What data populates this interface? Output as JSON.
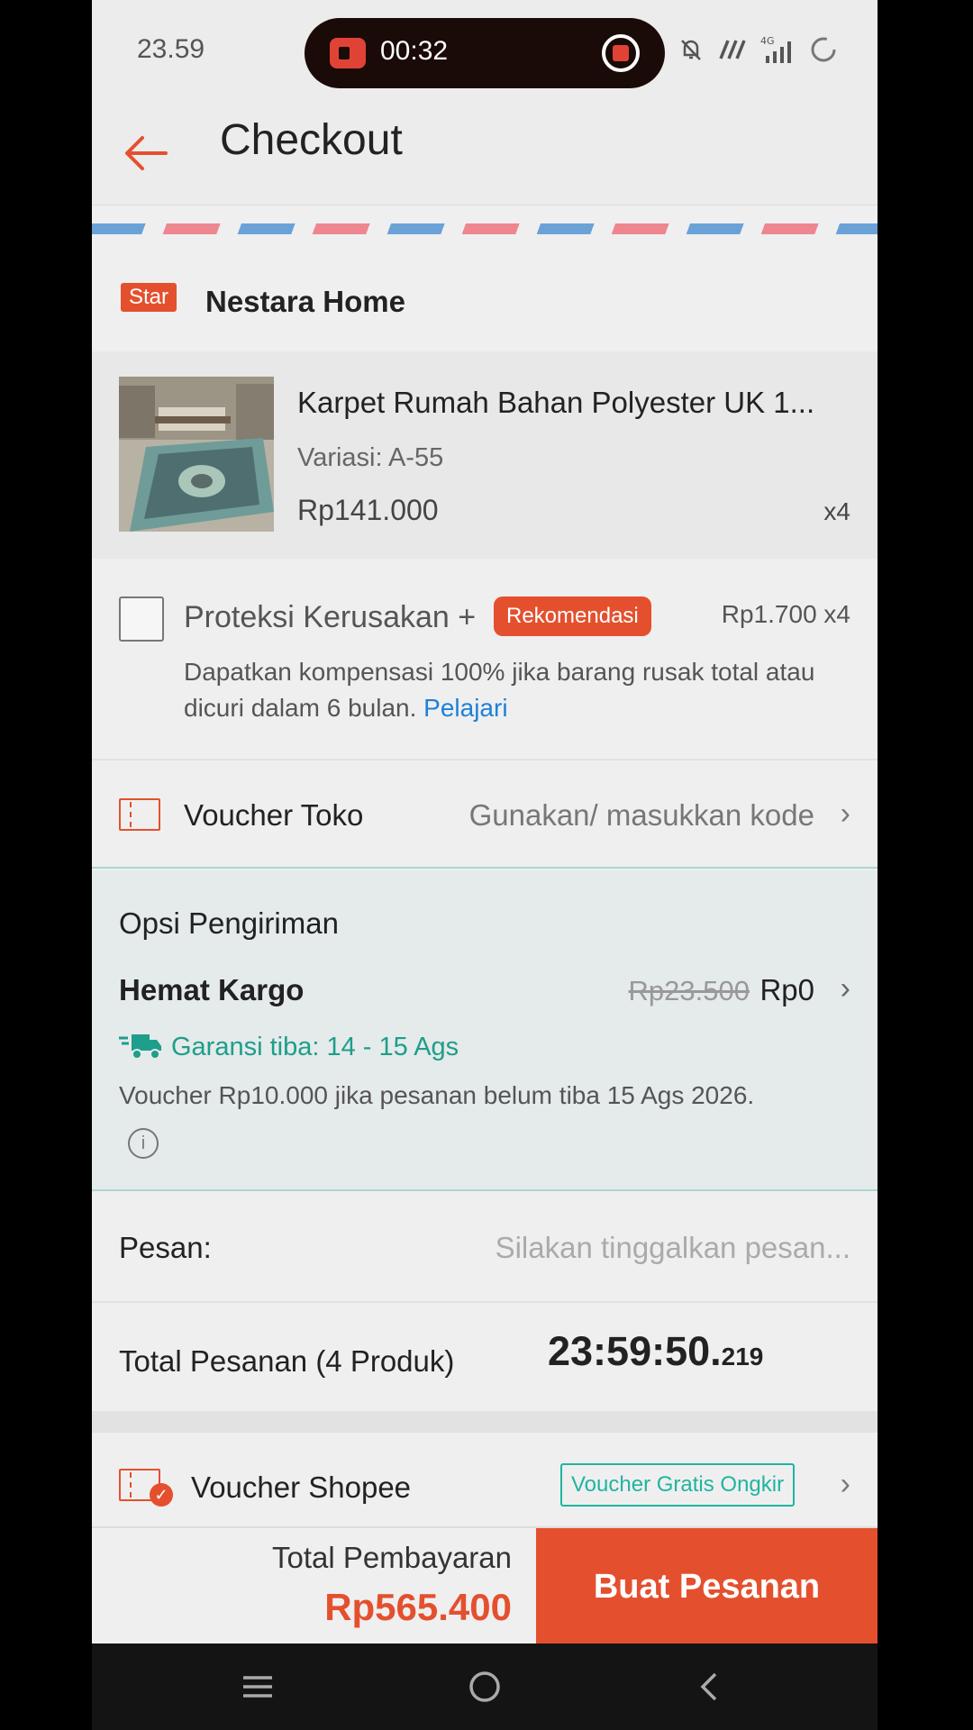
{
  "status": {
    "time": "23.59",
    "rec_timer": "00:32",
    "network": "4G"
  },
  "header": {
    "title": "Checkout"
  },
  "shop": {
    "badge": "Star",
    "name": "Nestara Home"
  },
  "product": {
    "name": "Karpet Rumah Bahan Polyester UK 1...",
    "variant": "Variasi: A-55",
    "price": "Rp141.000",
    "qty": "x4"
  },
  "protection": {
    "title": "Proteksi Kerusakan +",
    "badge": "Rekomendasi",
    "price": "Rp1.700  x4",
    "desc": "Dapatkan kompensasi 100% jika barang rusak total atau dicuri dalam 6 bulan.",
    "link": "Pelajari"
  },
  "voucher_toko": {
    "label": "Voucher Toko",
    "value": "Gunakan/ masukkan kode"
  },
  "shipping": {
    "heading": "Opsi Pengiriman",
    "method": "Hemat Kargo",
    "old_price": "Rp23.500",
    "new_price": "Rp0",
    "guarantee": "Garansi tiba: 14 - 15 Ags",
    "voucher_note": "Voucher Rp10.000 jika pesanan belum tiba 15 Ags 2026."
  },
  "message": {
    "label": "Pesan:",
    "placeholder": "Silakan tinggalkan pesan..."
  },
  "order_total": {
    "label": "Total Pesanan (4 Produk)",
    "clock_main": "23:59:50.",
    "clock_ms": "219"
  },
  "voucher_shopee": {
    "label": "Voucher Shopee",
    "tag": "Voucher Gratis Ongkir"
  },
  "footer": {
    "total_label": "Total Pembayaran",
    "total_value": "Rp565.400",
    "button": "Buat Pesanan"
  },
  "colors": {
    "accent": "#e4502e",
    "teal": "#1e9e8b",
    "link": "#1f80d8"
  }
}
